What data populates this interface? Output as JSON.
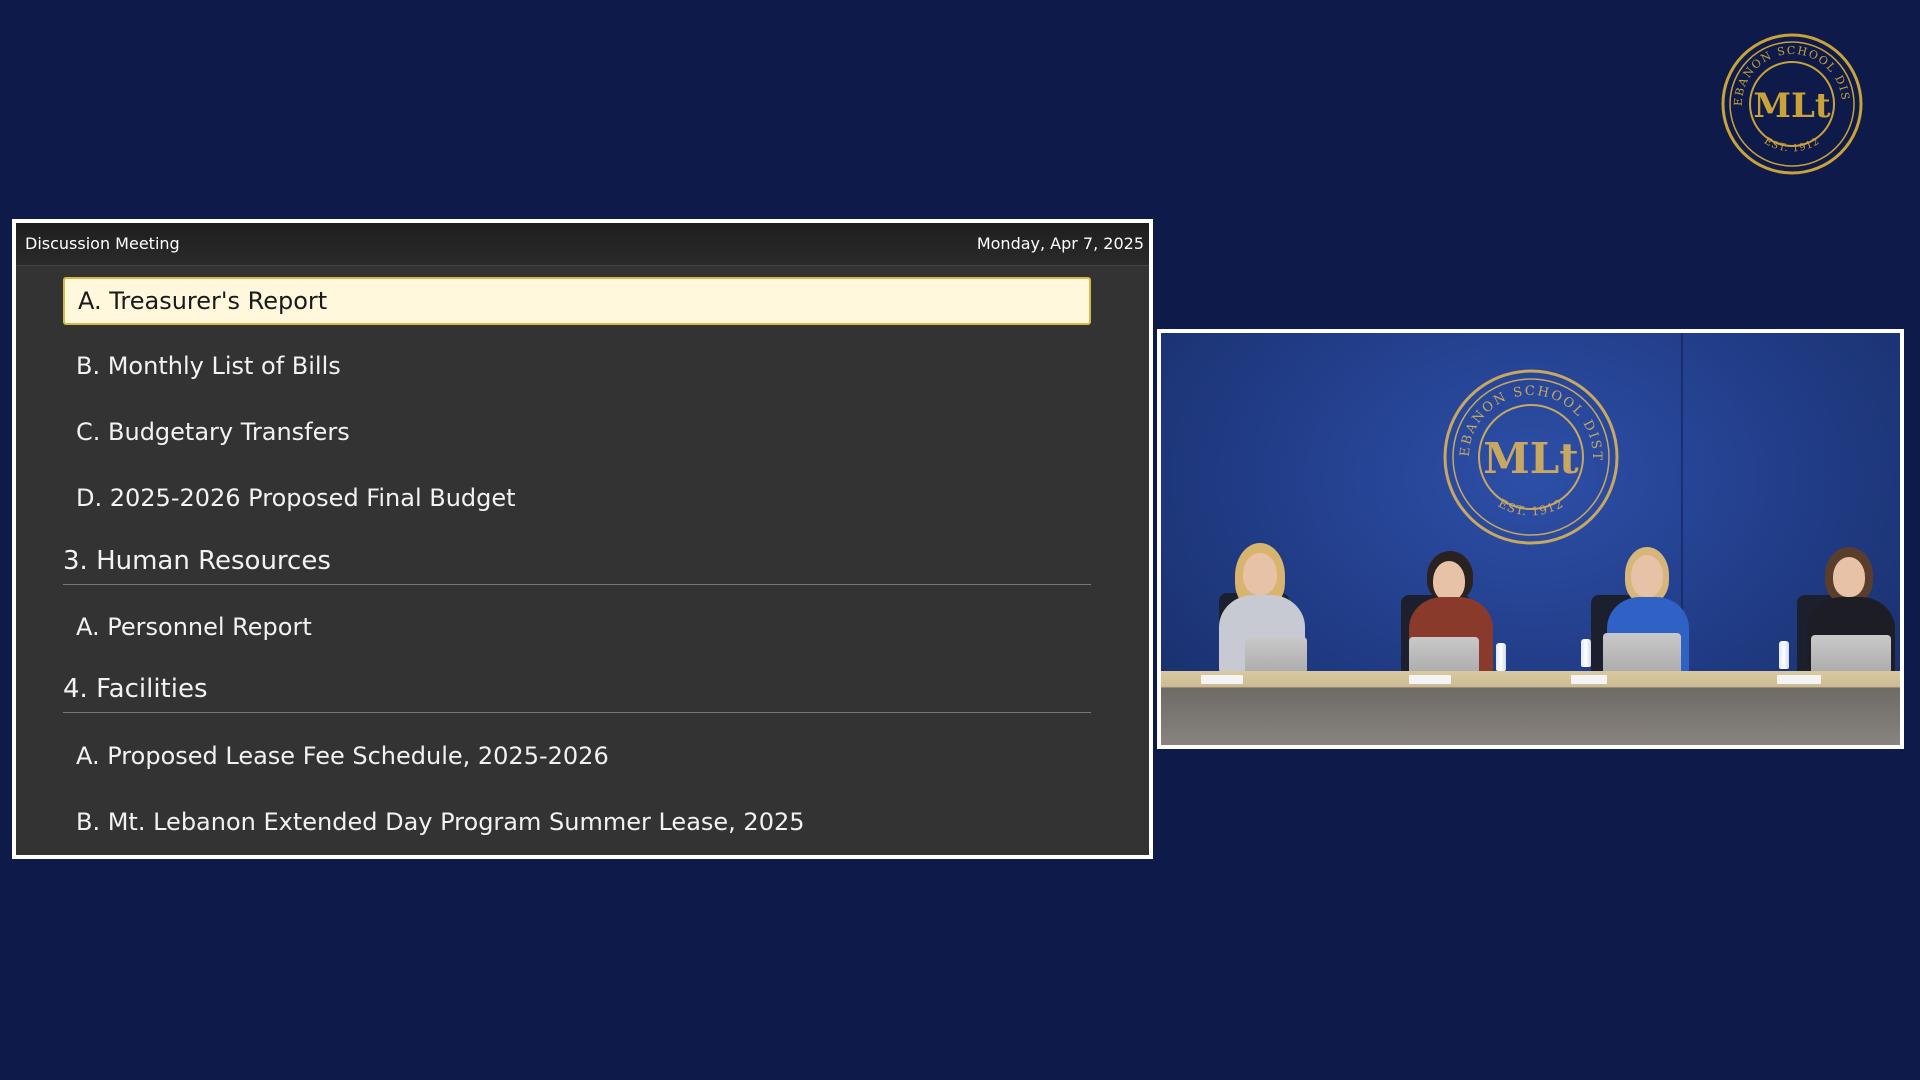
{
  "brand": {
    "seal_text": "MT. LEBANON SCHOOL DISTRICT",
    "seal_monogram": "MLt",
    "seal_est": "EST. 1912",
    "seal_color": "#c9a23a"
  },
  "agenda": {
    "meeting_type": "Discussion Meeting",
    "meeting_date": "Monday, Apr 7, 2025",
    "rows": [
      {
        "kind": "item",
        "label": "A. Treasurer's Report",
        "active": true
      },
      {
        "kind": "item",
        "label": "B. Monthly List of Bills",
        "active": false
      },
      {
        "kind": "item",
        "label": "C. Budgetary Transfers",
        "active": false
      },
      {
        "kind": "item",
        "label": "D. 2025-2026 Proposed Final Budget",
        "active": false
      },
      {
        "kind": "section",
        "label": "3. Human Resources"
      },
      {
        "kind": "item",
        "label": "A. Personnel Report",
        "active": false
      },
      {
        "kind": "section",
        "label": "4. Facilities"
      },
      {
        "kind": "item",
        "label": "A. Proposed Lease Fee Schedule, 2025-2026",
        "active": false
      },
      {
        "kind": "item",
        "label": "B. Mt. Lebanon Extended Day Program Summer Lease, 2025",
        "active": false
      }
    ]
  },
  "colors": {
    "background": "#0d1a4a",
    "panel": "#333333",
    "active_item": "#fff8dc",
    "active_border": "#d8b84a"
  }
}
